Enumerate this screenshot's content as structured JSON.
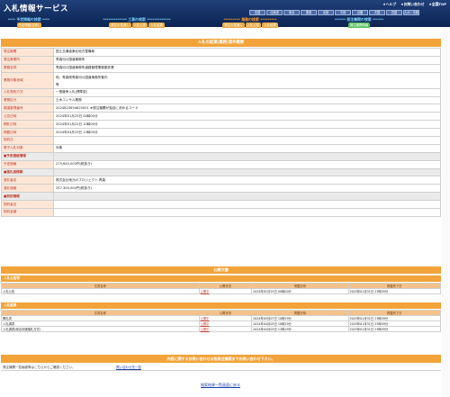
{
  "header": {
    "logo": "入札情報サービス",
    "links": [
      "★ヘルプ",
      "★お問い合わせ",
      "★全国TOP"
    ],
    "regions": [
      "全国",
      "北海道",
      "東北",
      "関東",
      "北陸",
      "中部",
      "近畿",
      "中国",
      "四国",
      "九州・沖縄"
    ]
  },
  "nav": {
    "categories": [
      {
        "title": "**** 予定情報の検索 ****",
        "color": "#7fd3ff",
        "tabs": [
          "予定情報(全体)"
        ],
        "tabcolor": "#e8ab46"
      },
      {
        "title": "************* 工事の検索 *************",
        "color": "#7fd3ff",
        "tabs": [
          "発注の見通し",
          "入札公告",
          "入札結果"
        ],
        "tabcolor": "#e8ab46"
      },
      {
        "title": "********* 業務の検索 *********",
        "color": "#ff9a2e",
        "tabs": [
          "発注の見通し",
          "入札公告",
          "入札結果"
        ],
        "tabcolor": "#e8ab46"
      },
      {
        "title": "****** 発注機関の検索 ******",
        "color": "#7fd3ff",
        "tabs": [
          "発注機関情報"
        ],
        "tabcolor": "#58c05e"
      }
    ]
  },
  "detail": {
    "title": "入札の結果(業務)案件概要",
    "rows": [
      {
        "k": "発注機関",
        "v": "国土交通省東北地方整備局"
      },
      {
        "k": "発注事業所",
        "v": "青森河川国道事務所"
      },
      {
        "k": "業務名称",
        "v": "青森河川国道事務所道路管理業務委託業"
      },
      {
        "k": "業務対象地域",
        "v": "他、青森県青森河川国道事務所管内",
        "v2": "等",
        "tall": true
      },
      {
        "k": "入札契約方式",
        "v": "一般競争入札(標準型)"
      },
      {
        "k": "業務区分",
        "v": "土木コンサル業務"
      },
      {
        "k": "調達整理番号",
        "v": "2024B23654620001 ★発注機関が独自に決めるコード"
      },
      {
        "k": "公告日時",
        "v": "2024年01月25日 00時00分"
      },
      {
        "k": "開札日時",
        "v": "2024年01月22日 10時00分"
      },
      {
        "k": "掲載日時",
        "v": "2024年03月19日 13時00分"
      },
      {
        "k": "契約日",
        "v": ""
      },
      {
        "k": "電子入札対象",
        "v": "対象"
      },
      {
        "k": "■予定価格情報",
        "v": "",
        "sec": true
      },
      {
        "k": "予定価格",
        "v": "275,640,000円(税抜き)"
      },
      {
        "k": "■落札者情報",
        "v": "",
        "sec": true
      },
      {
        "k": "落札者名",
        "v": "株式会社地元のプロジェクト 青森"
      },
      {
        "k": "落札価格",
        "v": "257,300,000円(税抜き)"
      },
      {
        "k": "■契約情報",
        "v": "",
        "sec": true
      },
      {
        "k": "契約者名",
        "v": ""
      },
      {
        "k": "契約金額",
        "v": ""
      }
    ]
  },
  "announcements": {
    "title": "公開文書",
    "koukoku": {
      "label": "入札公告等",
      "headers": [
        "文書名称",
        "公開状況",
        "掲載日時",
        "掲載終了日"
      ],
      "rows": [
        [
          "入札公告",
          "公開中",
          "2024年01月25日 00時00分",
          "2025年01月31日 23時59分"
        ]
      ]
    },
    "kekka": {
      "label": "入札結果",
      "headers": [
        "文書名称",
        "公開状況",
        "掲載日時",
        "掲載終了日"
      ],
      "rows": [
        [
          "開札書",
          "公開中",
          "2024年03月07日 10時19分",
          "2025年01月31日 23時59分"
        ],
        [
          "入札調書",
          "公開中",
          "2024年04月03日 10時19分",
          "2025年01月31日 23時59分"
        ],
        [
          "入札調書(総合評価落札方式)",
          "公開中",
          "2024年04月03日 13時19分",
          "2025年01月31日 23時59分"
        ]
      ]
    }
  },
  "notice": {
    "bar": "内容に関するお問い合わせは各発注機関までお問い合わせ下さい。",
    "left": "発注機関一覧画面等はこちらからご確認ください。",
    "right": "問い合わせ先一覧"
  },
  "back_link": "検索結果一覧画面に戻る",
  "colors": {
    "accent": "#f2a33a",
    "header": "#20407a",
    "keycell": "#fde6d6"
  }
}
